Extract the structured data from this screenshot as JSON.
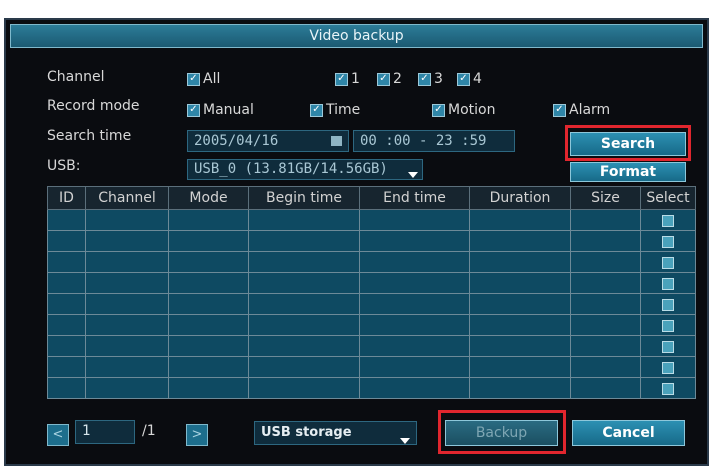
{
  "window": {
    "title": "Video backup"
  },
  "form": {
    "channel_label": "Channel",
    "channel_all": "All",
    "channels": [
      "1",
      "2",
      "3",
      "4"
    ],
    "record_mode_label": "Record mode",
    "record_modes": [
      "Manual",
      "Time",
      "Motion",
      "Alarm"
    ],
    "search_time_label": "Search time",
    "search_date": "2005/04/16",
    "search_time_range": "00 :00 - 23 :59",
    "usb_label": "USB:",
    "usb_value": "USB_0 (13.81GB/14.56GB)"
  },
  "buttons": {
    "search": "Search",
    "format": "Format",
    "backup": "Backup",
    "cancel": "Cancel"
  },
  "table": {
    "columns": [
      "ID",
      "Channel",
      "Mode",
      "Begin time",
      "End time",
      "Duration",
      "Size",
      "Select"
    ],
    "row_count": 9
  },
  "footer": {
    "page_current": "1",
    "page_total": "/1",
    "storage": "USB storage"
  },
  "colors": {
    "highlight": "#e0262e",
    "accent": "#2c90b3"
  }
}
